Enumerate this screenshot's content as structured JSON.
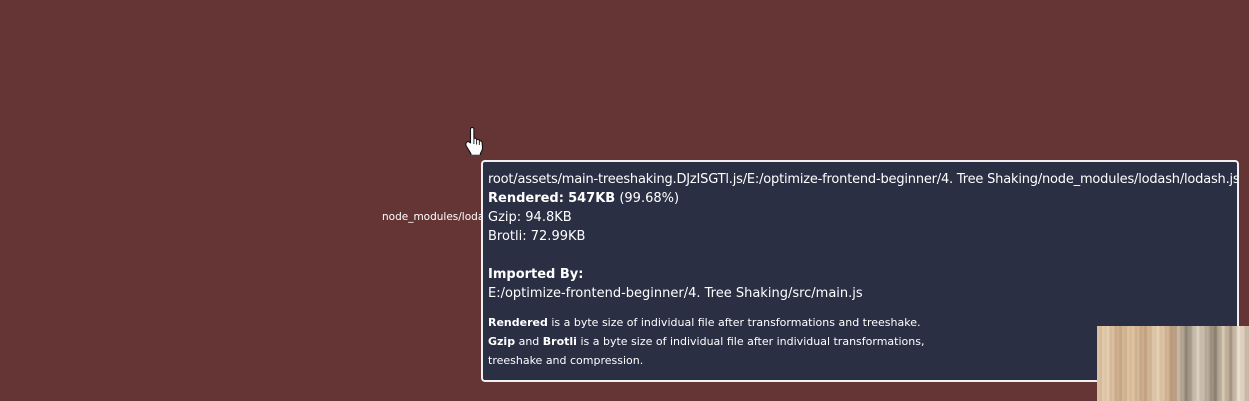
{
  "treemap": {
    "node_label": "node_modules/lodas"
  },
  "tooltip": {
    "path": "root/assets/main-treeshaking.DJzISGTl.js/E:/optimize-frontend-beginner/4. Tree Shaking/node_modules/lodash/lodash.js",
    "rendered_label": "Rendered:",
    "rendered_value": "547KB",
    "rendered_percent": "(99.68%)",
    "gzip": "Gzip: 94.8KB",
    "brotli": "Brotli: 72.99KB",
    "imported_by_label": "Imported By:",
    "imported_by_value": "E:/optimize-frontend-beginner/4. Tree Shaking/src/main.js",
    "note1_bold": "Rendered",
    "note1_rest": " is a byte size of individual file after transformations and treeshake.",
    "note2_bold1": "Gzip",
    "note2_and": " and ",
    "note2_bold2": "Brotli",
    "note2_rest": " is a byte size of individual file after individual transformations,",
    "note3": "treeshake and compression."
  },
  "colors": {
    "background": "#653535",
    "tooltip_bg": "#2a2f44",
    "tooltip_border": "#f0f0f2"
  },
  "icons": {
    "cursor": "hand-pointer-icon"
  }
}
